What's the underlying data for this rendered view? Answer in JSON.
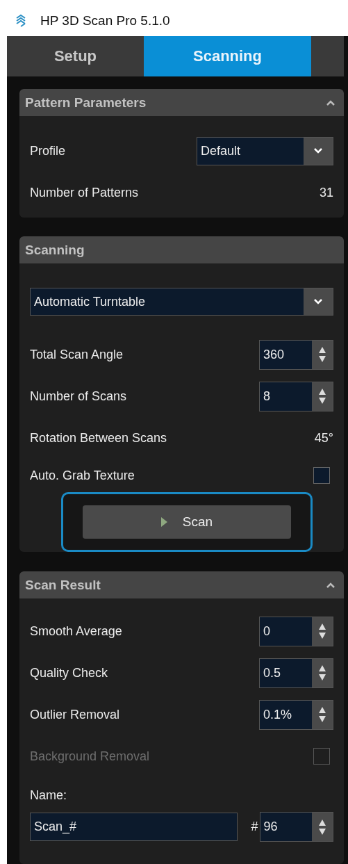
{
  "window": {
    "title": "HP 3D Scan Pro 5.1.0"
  },
  "tabs": [
    {
      "label": "Setup",
      "selected": false
    },
    {
      "label": "Scanning",
      "selected": true
    }
  ],
  "sections": [
    {
      "title": "Pattern Parameters",
      "expanded": true,
      "rows": [
        {
          "kind": "dropdown",
          "label": "Profile",
          "value": "Default"
        },
        {
          "kind": "readout",
          "label": "Number of Patterns",
          "value": "31"
        }
      ]
    },
    {
      "title": "Scanning",
      "rows": [
        {
          "kind": "wide-dropdown",
          "value": "Automatic Turntable"
        },
        {
          "kind": "spinner",
          "label": "Total Scan Angle",
          "value": "360"
        },
        {
          "kind": "spinner",
          "label": "Number of Scans",
          "value": "8"
        },
        {
          "kind": "readout",
          "label": "Rotation Between Scans",
          "value": "45°"
        },
        {
          "kind": "checkbox",
          "label": "Auto. Grab Texture",
          "checked": false,
          "disabled": false
        },
        {
          "kind": "button",
          "label": "Scan",
          "highlighted": true
        }
      ]
    },
    {
      "title": "Scan Result",
      "expanded": true,
      "rows": [
        {
          "kind": "spinner",
          "label": "Smooth Average",
          "value": "0"
        },
        {
          "kind": "spinner",
          "label": "Quality Check",
          "value": "0.5"
        },
        {
          "kind": "spinner",
          "label": "Outlier Removal",
          "value": "0.1%"
        },
        {
          "kind": "checkbox",
          "label": "Background Removal",
          "checked": false,
          "disabled": true
        },
        {
          "kind": "name",
          "label": "Name:",
          "value": "Scan_#",
          "hash": "#",
          "number": "96"
        }
      ]
    }
  ]
}
